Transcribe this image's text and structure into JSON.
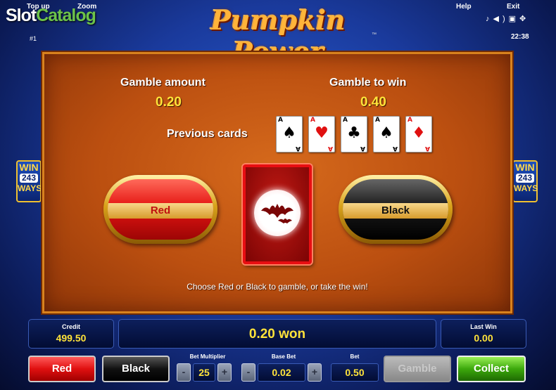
{
  "header": {
    "top_up": "Top up",
    "zoom": "Zoom",
    "watermark_pre": "Slot",
    "watermark_acc": "Catalog",
    "line_number": "#1",
    "title": "Pumpkin Power",
    "trademark": "™",
    "help": "Help",
    "exit": "Exit",
    "sys_icons": "♪◀)▣✥",
    "clock": "22:38"
  },
  "side_badge": {
    "win": "WIN",
    "number": "243",
    "ways": "WAYS"
  },
  "gamble": {
    "amount_label": "Gamble amount",
    "amount_value": "0.20",
    "to_win_label": "Gamble to win",
    "to_win_value": "0.40",
    "previous_cards_label": "Previous cards",
    "previous_cards": [
      {
        "rank": "A",
        "suit": "♠",
        "color": "#000000"
      },
      {
        "rank": "A",
        "suit": "♥",
        "color": "#e01010"
      },
      {
        "rank": "A",
        "suit": "♣",
        "color": "#000000"
      },
      {
        "rank": "A",
        "suit": "♠",
        "color": "#000000"
      },
      {
        "rank": "A",
        "suit": "♦",
        "color": "#e01010"
      }
    ],
    "red_label": "Red",
    "black_label": "Black",
    "hint": "Choose Red or Black to gamble, or take the win!"
  },
  "bottom": {
    "credit_label": "Credit",
    "credit_value": "499.50",
    "won_text": "0.20 won",
    "last_win_label": "Last Win",
    "last_win_value": "0.00"
  },
  "controls": {
    "red": "Red",
    "black": "Black",
    "bet_multiplier_label": "Bet Multiplier",
    "bet_multiplier": "25",
    "base_bet_label": "Base Bet",
    "base_bet": "0.02",
    "bet_label": "Bet",
    "bet": "0.50",
    "minus": "-",
    "plus": "+",
    "gamble": "Gamble",
    "collect": "Collect"
  },
  "colors": {
    "accent_yellow": "#ffe33a",
    "panel_orange": "#c4561a",
    "card_red": "#e80e12"
  }
}
